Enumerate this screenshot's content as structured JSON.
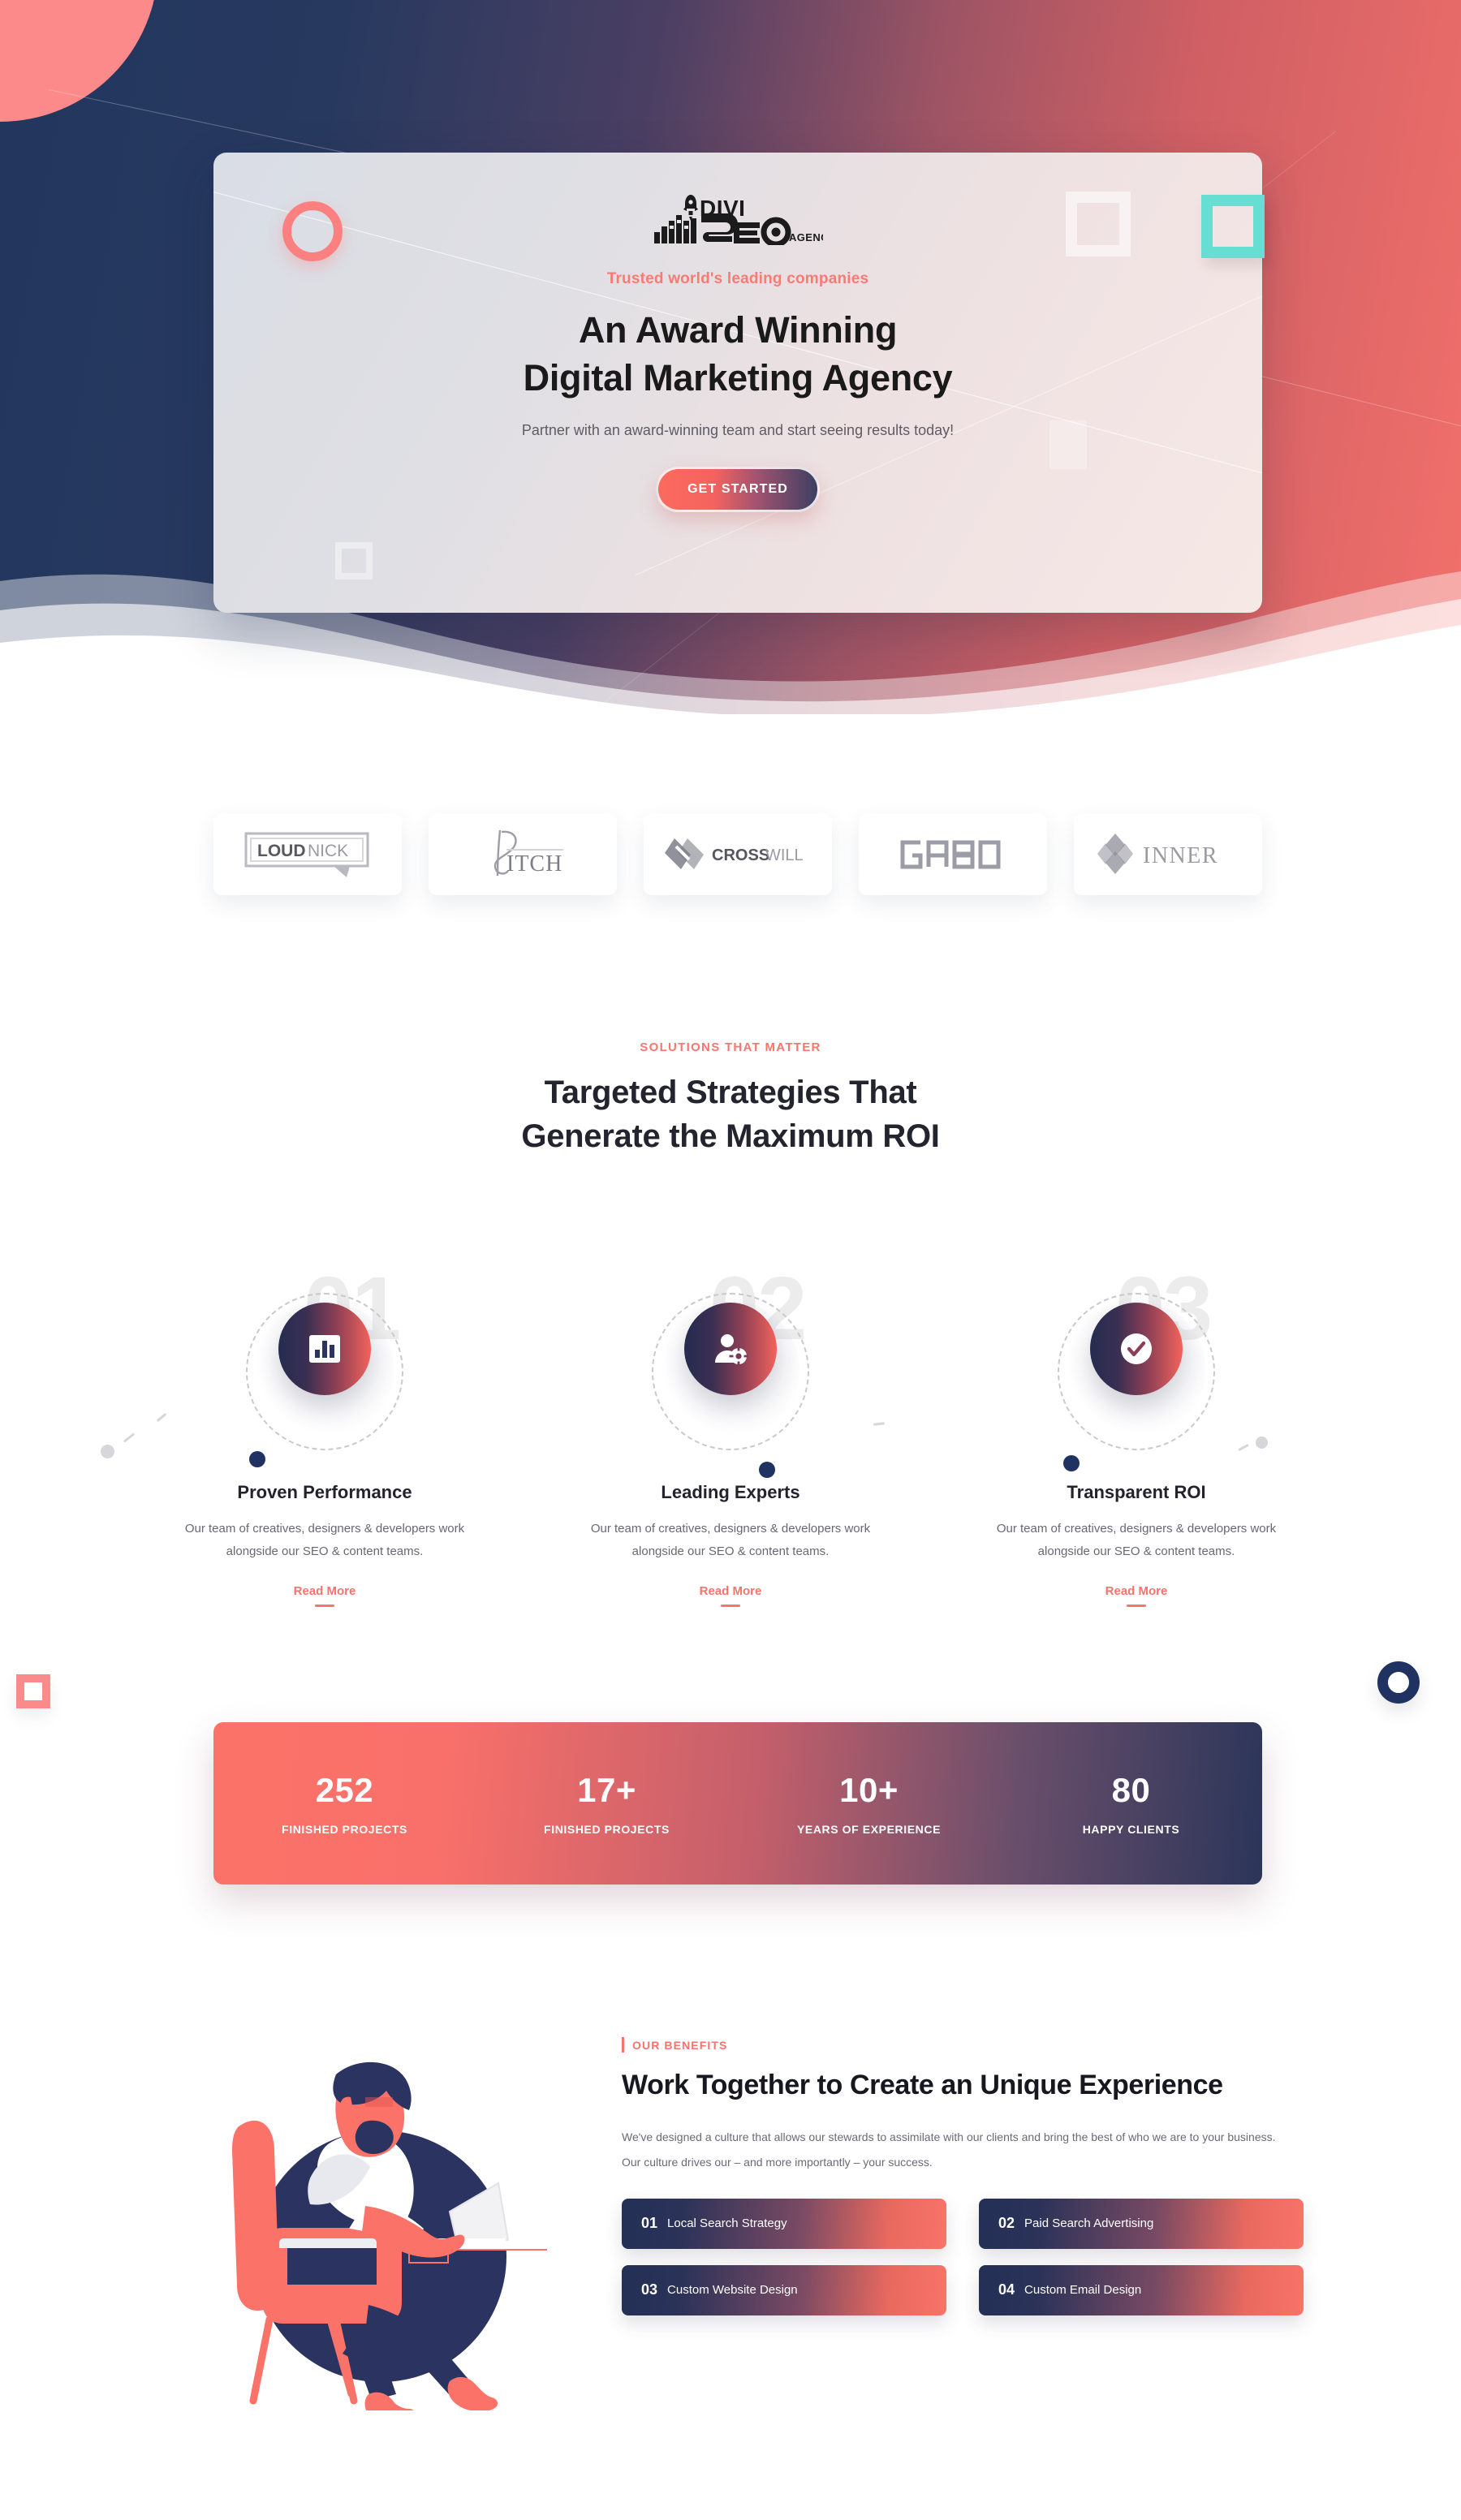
{
  "hero": {
    "logo": {
      "name": "divi-seo-agency-logo",
      "text_main": "DIVI",
      "text_sub": "SEO",
      "text_suffix": "AGENCY"
    },
    "eyebrow": "Trusted world's leading companies",
    "title_line1": "An Award Winning",
    "title_line2": "Digital Marketing Agency",
    "subtitle": "Partner with an award-winning team and start seeing results today!",
    "cta_label": "GET STARTED",
    "colors": {
      "navy": "#22365e",
      "coral": "#fb7268",
      "teal": "#66ded2",
      "pink": "#fc8a8a"
    }
  },
  "clients": [
    {
      "name": "loudnick",
      "label": "LOUDNICK",
      "bold_part": "LOUD",
      "light_part": "NICK"
    },
    {
      "name": "pitch",
      "label": "PITCH",
      "light_part": "ITCH"
    },
    {
      "name": "crosswill",
      "label": "CROSSWILL",
      "bold_part": "CROSS",
      "light_part": "WILL"
    },
    {
      "name": "gabo",
      "label": "GABO"
    },
    {
      "name": "inner",
      "label": "INNER"
    }
  ],
  "solutions": {
    "eyebrow": "SOLUTIONS THAT MATTER",
    "title_line1": "Targeted Strategies That",
    "title_line2": "Generate the Maximum ROI",
    "items": [
      {
        "number": "01",
        "icon": "bar-chart-icon",
        "title": "Proven Performance",
        "desc": "Our team of creatives, designers & developers work alongside our SEO & content teams.",
        "link": "Read More"
      },
      {
        "number": "02",
        "icon": "user-gear-icon",
        "title": "Leading Experts",
        "desc": "Our team of creatives, designers & developers work alongside our SEO & content teams.",
        "link": "Read More"
      },
      {
        "number": "03",
        "icon": "check-circle-icon",
        "title": "Transparent ROI",
        "desc": "Our team of creatives, designers & developers work alongside our SEO & content teams.",
        "link": "Read More"
      }
    ]
  },
  "stats": [
    {
      "number": "252",
      "label": "FINISHED PROJECTS"
    },
    {
      "number": "17+",
      "label": "FINISHED PROJECTS"
    },
    {
      "number": "10+",
      "label": "YEARS OF EXPERIENCE"
    },
    {
      "number": "80",
      "label": "HAPPY CLIENTS"
    }
  ],
  "benefits": {
    "eyebrow": "OUR BENEFITS",
    "title": "Work Together to Create an Unique Experience",
    "desc": "We've designed a culture that allows our stewards to assimilate with our clients and bring the best of who we are to your business. Our culture drives our – and more importantly – your success.",
    "illustration": "man-on-chair-with-laptop-illustration",
    "items": [
      {
        "number": "01",
        "label": "Local Search Strategy"
      },
      {
        "number": "02",
        "label": "Paid Search Advertising"
      },
      {
        "number": "03",
        "label": "Custom Website Design"
      },
      {
        "number": "04",
        "label": "Custom Email Design"
      }
    ]
  }
}
